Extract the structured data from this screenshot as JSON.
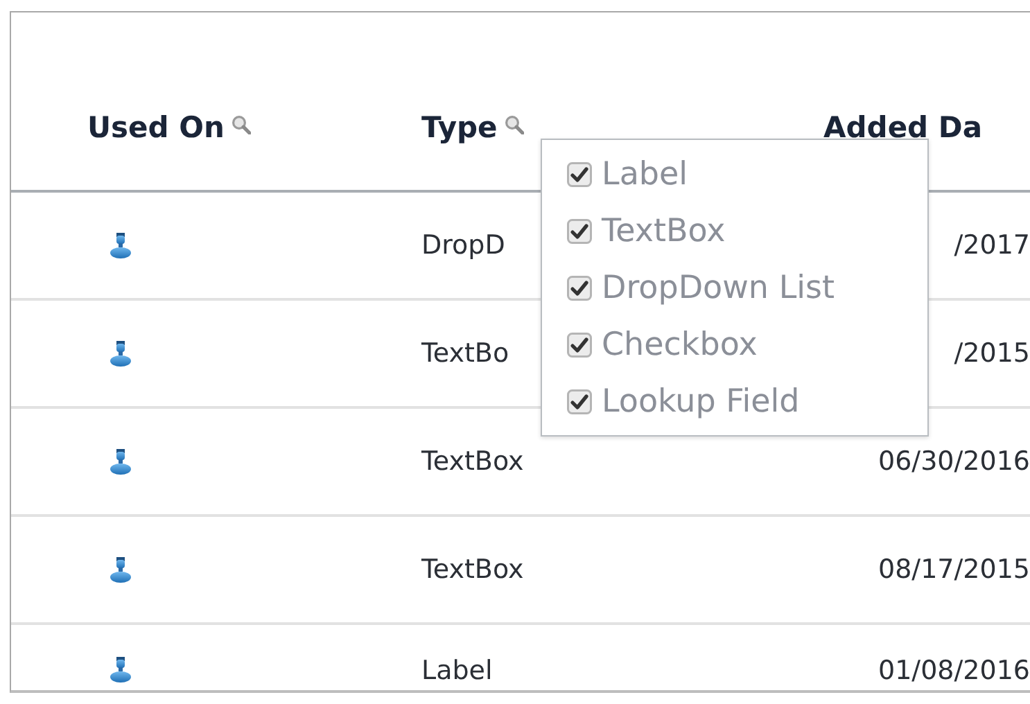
{
  "table": {
    "columns": [
      {
        "label": "Used On",
        "filter": true
      },
      {
        "label": "Type",
        "filter": true
      },
      {
        "label": "Added Da",
        "filter": false
      }
    ],
    "rows": [
      {
        "type": "DropD",
        "added": "/2017"
      },
      {
        "type": "TextBo",
        "added": "/2015"
      },
      {
        "type": "TextBox",
        "added": "06/30/2016"
      },
      {
        "type": "TextBox",
        "added": "08/17/2015"
      },
      {
        "type": "Label",
        "added": "01/08/2016"
      }
    ]
  },
  "type_filter_menu": {
    "items": [
      {
        "label": "Label",
        "checked": true
      },
      {
        "label": "TextBox",
        "checked": true
      },
      {
        "label": "DropDown List",
        "checked": true
      },
      {
        "label": "Checkbox",
        "checked": true
      },
      {
        "label": "Lookup Field",
        "checked": true
      }
    ]
  }
}
